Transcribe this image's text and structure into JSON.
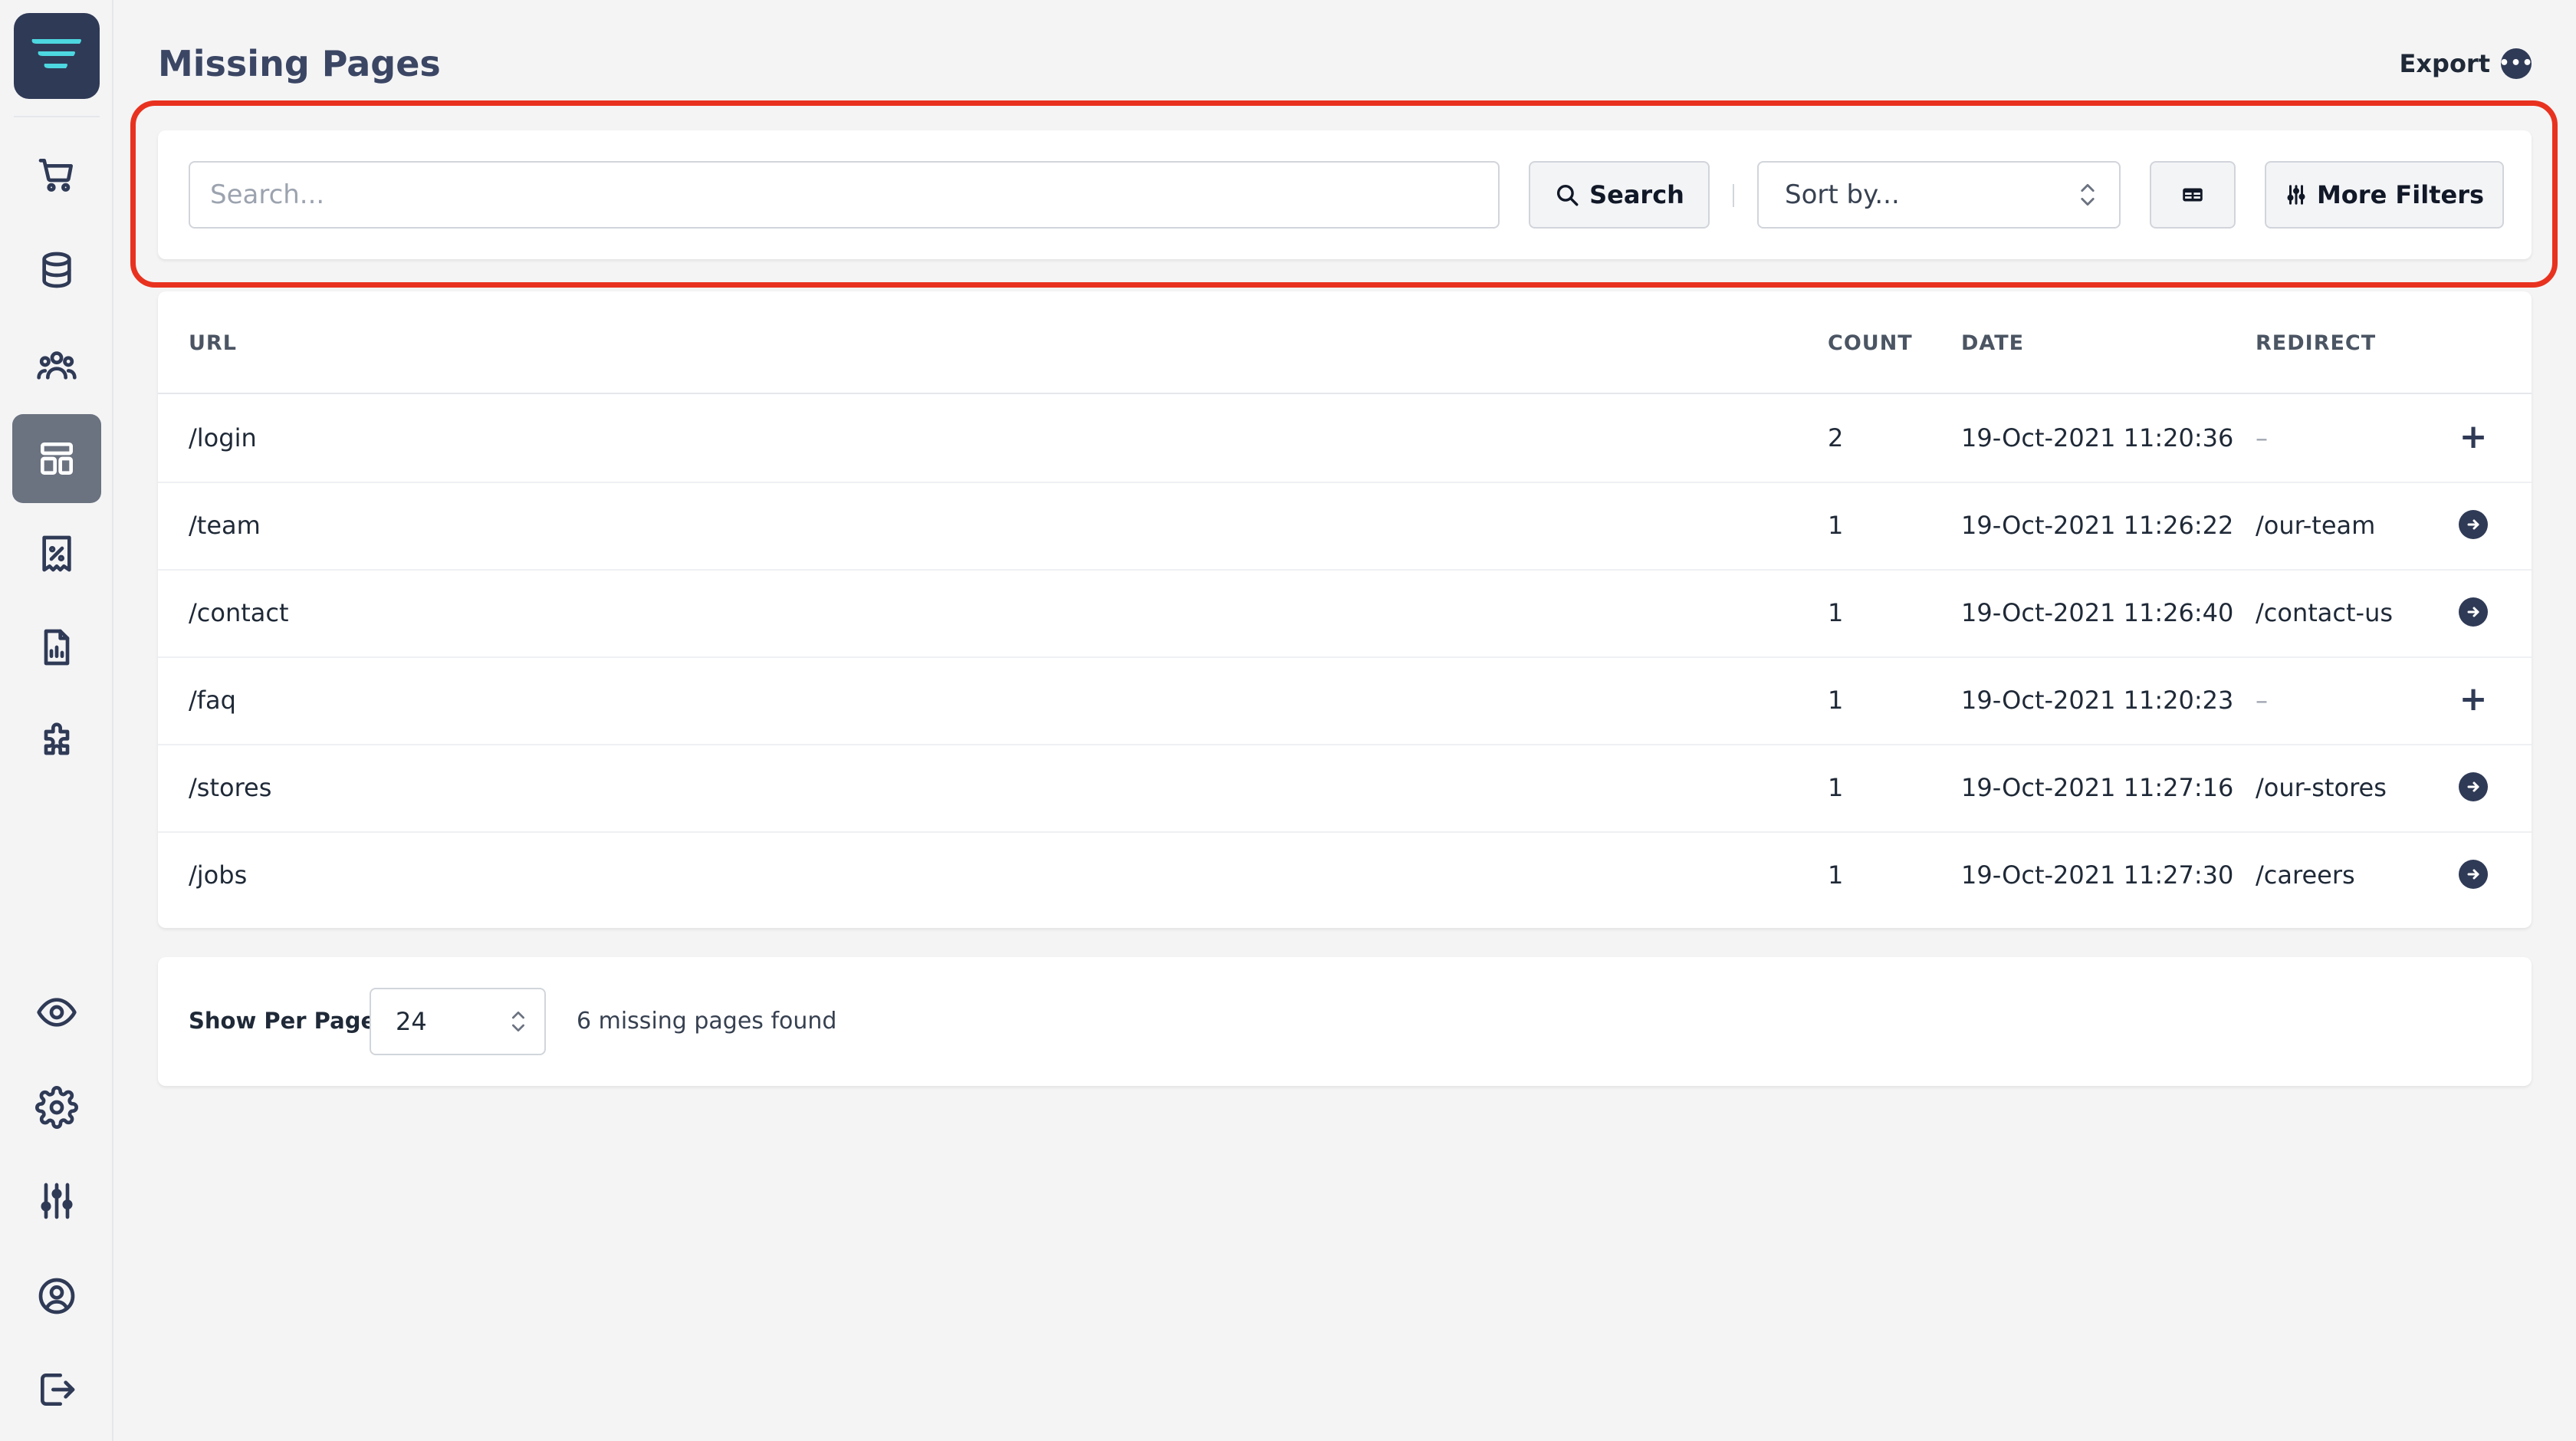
{
  "header": {
    "title": "Missing Pages",
    "export_label": "Export"
  },
  "filters": {
    "search_placeholder": "Search...",
    "search_button": "Search",
    "sort_placeholder": "Sort by...",
    "more_filters_button": "More Filters"
  },
  "table": {
    "columns": {
      "url": "URL",
      "count": "COUNT",
      "date": "DATE",
      "redirect": "REDIRECT"
    },
    "rows": [
      {
        "url": "/login",
        "count": "2",
        "date": "19-Oct-2021 11:20:36",
        "redirect": "–",
        "action": "add"
      },
      {
        "url": "/team",
        "count": "1",
        "date": "19-Oct-2021 11:26:22",
        "redirect": "/our-team",
        "action": "go"
      },
      {
        "url": "/contact",
        "count": "1",
        "date": "19-Oct-2021 11:26:40",
        "redirect": "/contact-us",
        "action": "go"
      },
      {
        "url": "/faq",
        "count": "1",
        "date": "19-Oct-2021 11:20:23",
        "redirect": "–",
        "action": "add"
      },
      {
        "url": "/stores",
        "count": "1",
        "date": "19-Oct-2021 11:27:16",
        "redirect": "/our-stores",
        "action": "go"
      },
      {
        "url": "/jobs",
        "count": "1",
        "date": "19-Oct-2021 11:27:30",
        "redirect": "/careers",
        "action": "go"
      }
    ]
  },
  "footer": {
    "per_page_label": "Show Per Page",
    "per_page_value": "24",
    "found_text": "6 missing pages found"
  },
  "sidebar": {
    "items": [
      "cart-icon",
      "database-icon",
      "users-icon",
      "layout-icon",
      "receipt-percent-icon",
      "report-icon",
      "puzzle-icon",
      "eye-icon",
      "gear-icon",
      "sliders-icon",
      "user-circle-icon",
      "logout-icon"
    ],
    "active": "layout-icon"
  },
  "colors": {
    "brand": "#2f3a56",
    "logo_accent": "#4dd7e0",
    "highlight": "#e8321f",
    "active_nav": "#6b7280"
  }
}
